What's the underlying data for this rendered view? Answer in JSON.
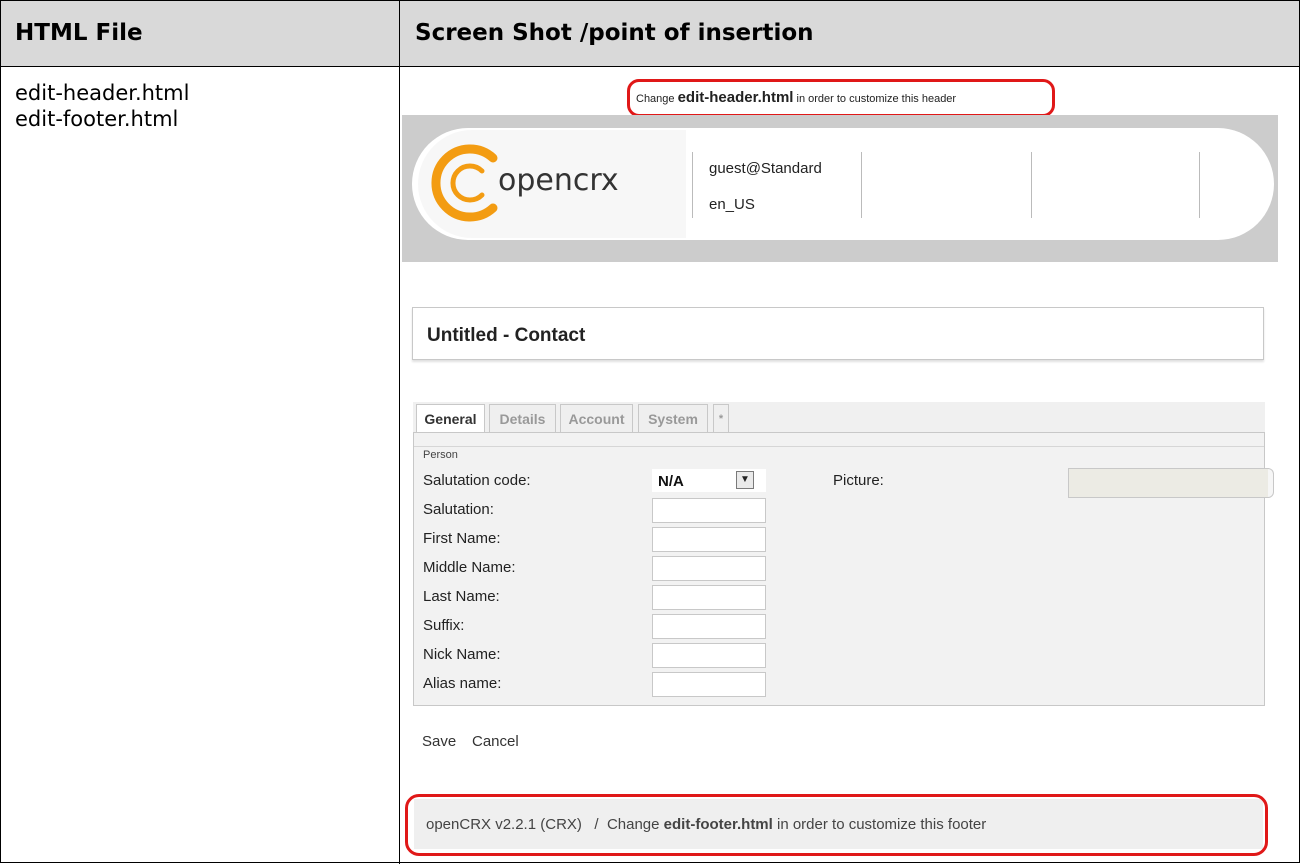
{
  "doc": {
    "col1_header": "HTML File",
    "col2_header": "Screen Shot /point of insertion",
    "files": [
      "edit-header.html",
      "edit-footer.html"
    ]
  },
  "header_note": {
    "prefix": "Change ",
    "file": "edit-header.html",
    "suffix": " in order to customize this header"
  },
  "app": {
    "logo_text": "opencrx",
    "user": "guest@Standard",
    "locale": "en_US"
  },
  "page": {
    "title": "Untitled - Contact"
  },
  "tabs": [
    "General",
    "Details",
    "Account",
    "System",
    "*"
  ],
  "form": {
    "section": "Person",
    "salutation_code_label": "Salutation code:",
    "salutation_code_value": "N/A",
    "picture_label": "Picture:",
    "labels": [
      "Salutation:",
      "First Name:",
      "Middle Name:",
      "Last Name:",
      "Suffix:",
      "Nick Name:",
      "Alias name:"
    ]
  },
  "actions": {
    "save": "Save",
    "cancel": "Cancel"
  },
  "footer": {
    "version": "openCRX v2.2.1 (CRX)",
    "sep": "/",
    "prefix": "Change ",
    "file": "edit-footer.html",
    "suffix": " in order to customize this footer"
  },
  "colors": {
    "accent_red": "#e01818",
    "logo_orange": "#f39c12",
    "header_gray": "#cccccc"
  }
}
